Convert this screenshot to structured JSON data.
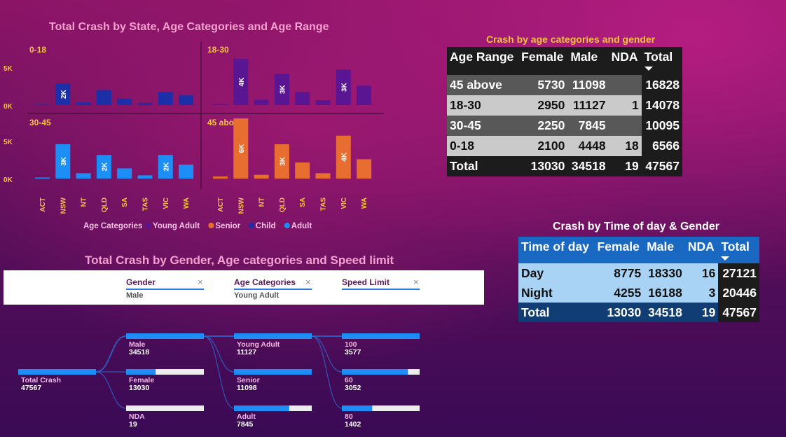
{
  "chart1": {
    "title": "Total Crash by State, Age Categories and Age Range",
    "panels": [
      {
        "label": "0-18",
        "color": "#1c2fa8",
        "values": [
          50,
          2000,
          250,
          1400,
          600,
          200,
          1200,
          900
        ],
        "labels": {
          "1": "2K"
        }
      },
      {
        "label": "18-30",
        "color": "#5a1592",
        "values": [
          50,
          4300,
          500,
          2900,
          1200,
          450,
          3300,
          1800
        ],
        "labels": {
          "1": "4K",
          "3": "3K",
          "6": "3K"
        }
      },
      {
        "label": "30-45",
        "color": "#1e8ef7",
        "values": [
          100,
          3200,
          500,
          2200,
          950,
          300,
          2200,
          1300
        ],
        "labels": {
          "1": "3K",
          "3": "2K",
          "6": "2K"
        }
      },
      {
        "label": "45 above",
        "color": "#e76d31",
        "values": [
          200,
          5600,
          350,
          3200,
          1500,
          500,
          4000,
          1800
        ],
        "labels": {
          "1": "6K",
          "3": "3K",
          "6": "4K"
        }
      }
    ],
    "states": [
      "ACT",
      "NSW",
      "NT",
      "QLD",
      "SA",
      "TAS",
      "VIC",
      "WA"
    ],
    "yticks": [
      "5K",
      "0K"
    ],
    "legend": {
      "title": "Age Categories",
      "items": [
        {
          "name": "Young Adult",
          "color": "#5a1592"
        },
        {
          "name": "Senior",
          "color": "#e76d31"
        },
        {
          "name": "Child",
          "color": "#1c2fa8"
        },
        {
          "name": "Adult",
          "color": "#1e8ef7"
        }
      ]
    }
  },
  "table1": {
    "title": "Crash by age categories and gender",
    "headers": [
      "Age Range",
      "Female",
      "Male",
      "NDA",
      "Total"
    ],
    "rows": [
      [
        "45 above",
        "5730",
        "11098",
        "",
        "16828"
      ],
      [
        "18-30",
        "2950",
        "11127",
        "1",
        "14078"
      ],
      [
        "30-45",
        "2250",
        "7845",
        "",
        "10095"
      ],
      [
        "0-18",
        "2100",
        "4448",
        "18",
        "6566"
      ]
    ],
    "total": [
      "Total",
      "13030",
      "34518",
      "19",
      "47567"
    ]
  },
  "table2": {
    "title": "Crash by Time of day & Gender",
    "headers": [
      "Time of day",
      "Female",
      "Male",
      "NDA",
      "Total"
    ],
    "rows": [
      [
        "Day",
        "8775",
        "18330",
        "16",
        "27121"
      ],
      [
        "Night",
        "4255",
        "16188",
        "3",
        "20446"
      ]
    ],
    "total": [
      "Total",
      "13030",
      "34518",
      "19",
      "47567"
    ]
  },
  "tree": {
    "title": "Total Crash by Gender, Age categories and Speed limit",
    "filters": [
      {
        "label": "Gender",
        "value": "Male"
      },
      {
        "label": "Age Categories",
        "value": "Young Adult"
      },
      {
        "label": "Speed Limit",
        "value": ""
      }
    ],
    "root": {
      "name": "Total Crash",
      "value": "47567",
      "fill": 1.0
    },
    "levels": [
      [
        {
          "name": "Male",
          "value": "34518",
          "fill": 1.0
        },
        {
          "name": "Female",
          "value": "13030",
          "fill": 0.38
        },
        {
          "name": "NDA",
          "value": "19",
          "fill": 0.0
        }
      ],
      [
        {
          "name": "Young Adult",
          "value": "11127",
          "fill": 1.0
        },
        {
          "name": "Senior",
          "value": "11098",
          "fill": 1.0
        },
        {
          "name": "Adult",
          "value": "7845",
          "fill": 0.71
        }
      ],
      [
        {
          "name": "100",
          "value": "3577",
          "fill": 1.0
        },
        {
          "name": "60",
          "value": "3052",
          "fill": 0.85
        },
        {
          "name": "80",
          "value": "1402",
          "fill": 0.39
        }
      ]
    ]
  }
}
